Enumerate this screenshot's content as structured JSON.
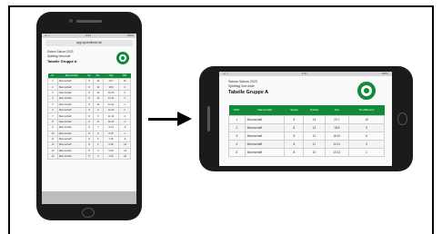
{
  "colors": {
    "brand_green": "#118a3c",
    "frame": "#000000"
  },
  "portrait": {
    "status_left": "••• ≈",
    "status_time": "9:41",
    "status_right": "100%",
    "url": "app.sportdirekt.de",
    "meta_line1": "Saison  Saison 2023",
    "meta_line2": "Spieltag  Vorrunde",
    "title": "Tabelle Gruppe A",
    "logo_icon": "club-crest-icon",
    "headers": [
      "Pl.",
      "Mannschaft",
      "Sp.",
      "Pkt.",
      "Tore",
      "Diff."
    ],
    "rows": [
      [
        "1",
        "Mannschaft",
        "8",
        "14",
        "22:7",
        "15"
      ],
      [
        "2",
        "Mannschaft",
        "8",
        "13",
        "18:9",
        "9"
      ],
      [
        "3",
        "Mannschaft",
        "8",
        "12",
        "16:10",
        "6"
      ],
      [
        "4",
        "Mannschaft",
        "8",
        "11",
        "14:11",
        "3"
      ],
      [
        "5",
        "Mannschaft",
        "8",
        "10",
        "13:12",
        "1"
      ],
      [
        "6",
        "Mannschaft",
        "8",
        "9",
        "12:12",
        "0"
      ],
      [
        "7",
        "Mannschaft",
        "8",
        "9",
        "11:13",
        "-2"
      ],
      [
        "8",
        "Mannschaft",
        "8",
        "8",
        "10:13",
        "-3"
      ],
      [
        "9",
        "Mannschaft",
        "8",
        "7",
        "9:14",
        "-5"
      ],
      [
        "10",
        "Mannschaft",
        "8",
        "6",
        "8:15",
        "-7"
      ],
      [
        "11",
        "Mannschaft",
        "8",
        "5",
        "7:16",
        "-9"
      ],
      [
        "12",
        "Mannschaft",
        "8",
        "4",
        "6:18",
        "-12"
      ],
      [
        "13",
        "Mannschaft",
        "8",
        "3",
        "5:19",
        "-14"
      ],
      [
        "14",
        "Mannschaft",
        "8",
        "2",
        "4:20",
        "-16"
      ]
    ]
  },
  "landscape": {
    "status_left": "••• ≈",
    "status_time": "9:41",
    "status_right": "100%",
    "meta_line1": "Saison    Saison 2023",
    "meta_line2": "Spieltag   Vorrunde",
    "title": "Tabelle Gruppe A",
    "logo_icon": "club-crest-icon",
    "headers": [
      "Platz",
      "Mannschaft",
      "Spiele",
      "Punkte",
      "Tore",
      "Tor-Differenz"
    ],
    "rows": [
      [
        "1",
        "Mannschaft",
        "8",
        "14",
        "22:7",
        "15"
      ],
      [
        "2",
        "Mannschaft",
        "8",
        "13",
        "18:9",
        "9"
      ],
      [
        "3",
        "Mannschaft",
        "8",
        "12",
        "16:10",
        "6"
      ],
      [
        "4",
        "Mannschaft",
        "8",
        "11",
        "14:11",
        "3"
      ],
      [
        "5",
        "Mannschaft",
        "8",
        "10",
        "13:12",
        "1"
      ]
    ]
  }
}
